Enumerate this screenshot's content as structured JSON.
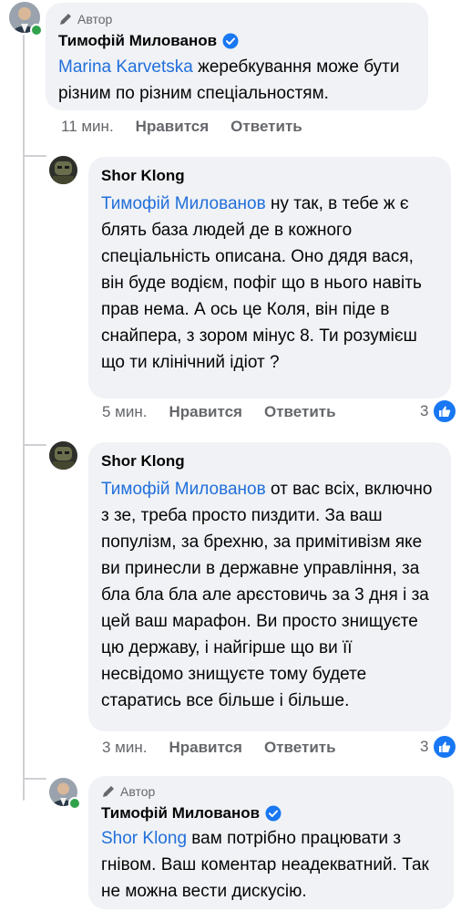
{
  "comments": [
    {
      "badge": "Автор",
      "author": "Тимофій Милованов",
      "mention": "Marina Karvetska",
      "text": " жеребкування може бути різним по різним спеціальностям.",
      "time": "11 мин.",
      "like_label": "Нравится",
      "reply_label": "Ответить"
    },
    {
      "author": "Shor Klong",
      "mention": "Тимофій Милованов",
      "text": " ну так, в тебе ж є блять база людей де в кожного спеціальність описана. Оно дядя вася, він буде водієм, пофіг що в нього навіть прав нема. А ось це Коля, він піде в снайпера, з зором мінус 8. Ти розумієш що ти клінічний ідіот ?",
      "time": "5 мин.",
      "like_label": "Нравится",
      "reply_label": "Ответить",
      "reaction_count": "3"
    },
    {
      "author": "Shor Klong",
      "mention": "Тимофій Милованов",
      "text": " от вас всіх, включно з зе, треба просто пиздити. За ваш популізм, за брехню, за примітивізм яке ви принесли в державне управління, за бла бла бла але арєстовичь за 3 дня і за цей ваш марафон. Ви просто знищуєте цю державу, і найгірше що ви її несвідомо знищуєте тому будете старатись все більше і більше.",
      "time": "3 мин.",
      "like_label": "Нравится",
      "reply_label": "Ответить",
      "reaction_count": "3"
    },
    {
      "badge": "Автор",
      "author": "Тимофій Милованов",
      "mention": "Shor Klong",
      "text": " вам потрібно працювати з гнівом. Ваш коментар неадекватний. Так не можна вести дискусію."
    }
  ],
  "colors": {
    "bubble": "#f0f2f5",
    "mention": "#216fdb",
    "meta": "#65676b",
    "like": "#1877f2",
    "verified": "#1877f2",
    "online": "#31a24c"
  },
  "icons": [
    "pen-icon",
    "verified-badge-icon",
    "like-reaction-icon"
  ]
}
